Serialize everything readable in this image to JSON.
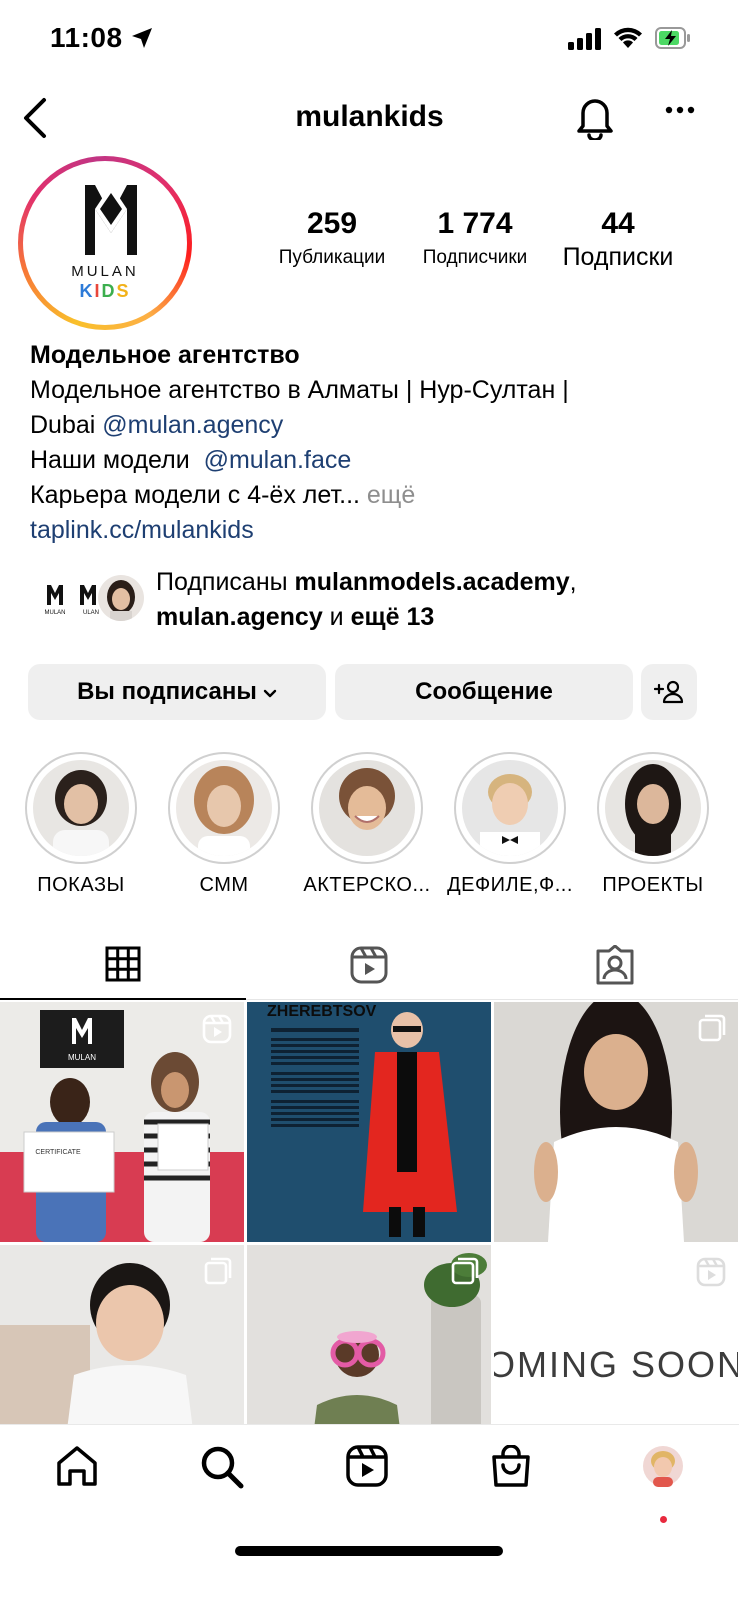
{
  "status_bar": {
    "time": "11:08"
  },
  "header": {
    "username": "mulankids"
  },
  "avatar": {
    "brand_text": "MULAN",
    "kids_letters": [
      "K",
      "I",
      "D",
      "S"
    ]
  },
  "stats": {
    "posts": {
      "value": "259",
      "label": "Публикации"
    },
    "followers": {
      "value": "1 774",
      "label": "Подписчики"
    },
    "following": {
      "value": "44",
      "label": "Подписки"
    }
  },
  "bio": {
    "name": "Модельное агентство",
    "line1": "Модельное агентство в Алматы | Нур-Султан |",
    "line2_text": "Dubai ",
    "line2_mention": "@mulan.agency",
    "line3_text": "Наши модели  ",
    "line3_mention": "@mulan.face",
    "line4_text": "Карьера модели с 4-ёх лет... ",
    "line4_more": "ещё",
    "link": "taplink.cc/mulankids"
  },
  "followed_by": {
    "prefix": "Подписаны ",
    "user1": "mulanmodels.academy",
    "sep": ",",
    "user2": "mulan.agency",
    "mid": " и ",
    "rest": "ещё 13"
  },
  "buttons": {
    "following": "Вы подписаны",
    "message": "Сообщение"
  },
  "highlights": [
    {
      "label": "ПОКАЗЫ"
    },
    {
      "label": "СММ"
    },
    {
      "label": "АКТЕРСКО..."
    },
    {
      "label": "ДЕФИЛЕ,Ф..."
    },
    {
      "label": "ПРОЕКТЫ"
    }
  ],
  "grid_posts": [
    {
      "type": "reel",
      "overlay_text": "MULAN",
      "certificate": "CERTIFICATE"
    },
    {
      "type": "image",
      "overlay_text": "ZHEREBTSOV"
    },
    {
      "type": "carousel"
    },
    {
      "type": "carousel"
    },
    {
      "type": "carousel"
    },
    {
      "type": "reel",
      "overlay_text": "OMING SOON"
    }
  ],
  "icons": {
    "back": "chevron-left-icon",
    "bell": "bell-icon",
    "more": "more-horizontal-icon",
    "add_user": "add-user-icon",
    "grid_tab": "grid-icon",
    "reels_tab": "reels-icon",
    "tagged_tab": "tagged-icon",
    "nav": [
      "home-icon",
      "search-icon",
      "reels-icon",
      "shop-icon",
      "profile-avatar"
    ]
  },
  "colors": {
    "link": "#1e3f72",
    "button_bg": "#efefef",
    "notification_dot": "#e8293e"
  }
}
